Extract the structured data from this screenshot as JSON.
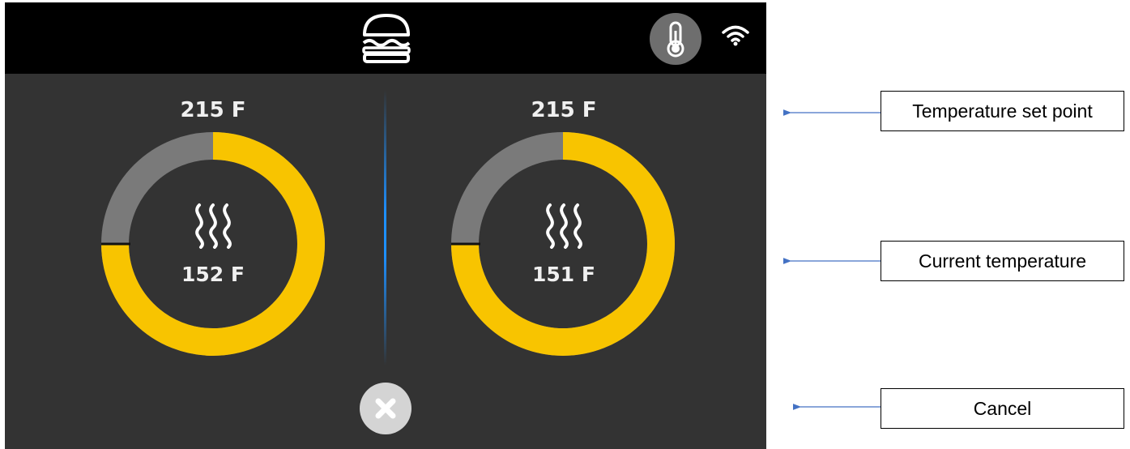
{
  "header": {
    "logo_icon": "burger-icon",
    "temperature_icon": "thermometer-icon",
    "wifi_icon": "wifi-icon"
  },
  "zones": [
    {
      "set_point": "215 F",
      "current": "152 F",
      "progress": 0.75,
      "icon": "steam-heat-icon"
    },
    {
      "set_point": "215 F",
      "current": "151 F",
      "progress": 0.75,
      "icon": "steam-heat-icon"
    }
  ],
  "cancel": {
    "icon": "close-icon"
  },
  "annotations": {
    "set_point": "Temperature set point",
    "current": "Current temperature",
    "cancel": "Cancel"
  },
  "colors": {
    "screen_bg": "#333333",
    "topbar_bg": "#000000",
    "ring_fill": "#f8c400",
    "ring_track": "#7a7a7a",
    "divider": "#1e90ff",
    "arrow": "#4472c4"
  }
}
